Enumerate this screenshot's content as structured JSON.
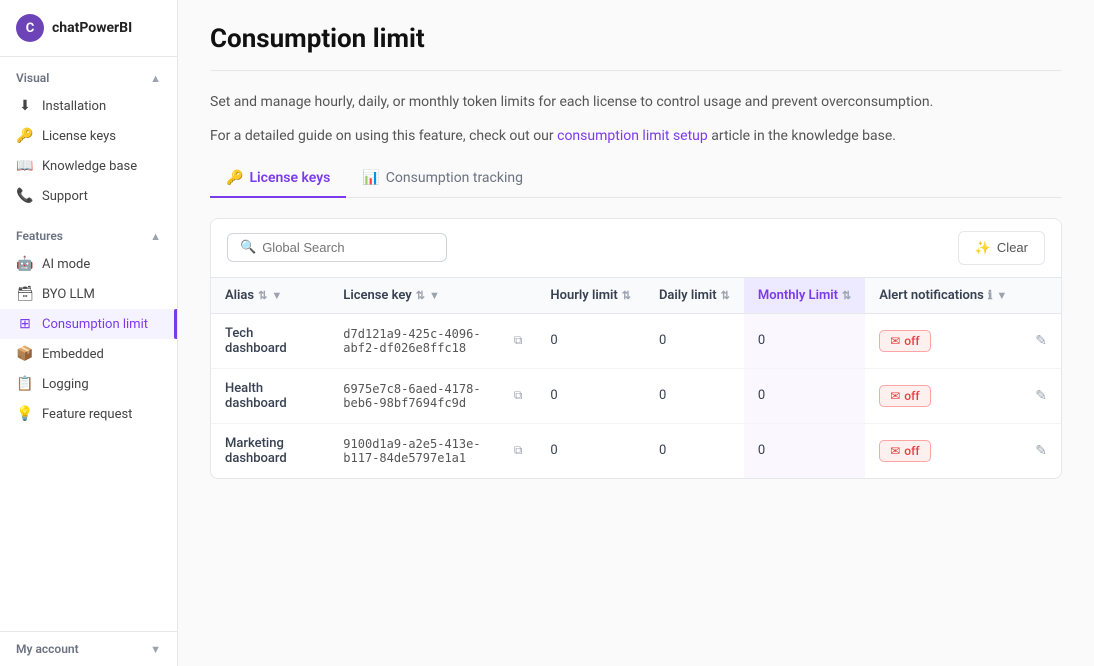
{
  "app": {
    "name": "chatPowerBI",
    "logo_initial": "C"
  },
  "sidebar": {
    "section_visual": "Visual",
    "section_features": "Features",
    "section_myaccount": "My account",
    "items_visual": [
      {
        "id": "installation",
        "label": "Installation",
        "icon": "⬇"
      },
      {
        "id": "license-keys",
        "label": "License keys",
        "icon": "🔑"
      },
      {
        "id": "knowledge-base",
        "label": "Knowledge base",
        "icon": "📖"
      },
      {
        "id": "support",
        "label": "Support",
        "icon": "📞"
      }
    ],
    "items_features": [
      {
        "id": "ai-mode",
        "label": "AI mode",
        "icon": "🤖"
      },
      {
        "id": "byo-llm",
        "label": "BYO LLM",
        "icon": "🗃"
      },
      {
        "id": "consumption-limit",
        "label": "Consumption limit",
        "icon": "⊞",
        "active": true
      },
      {
        "id": "embedded",
        "label": "Embedded",
        "icon": "📦"
      },
      {
        "id": "logging",
        "label": "Logging",
        "icon": "📋"
      },
      {
        "id": "feature-request",
        "label": "Feature request",
        "icon": "💡"
      }
    ],
    "items_myaccount": [
      {
        "id": "my-account",
        "label": "My account",
        "icon": "👤"
      }
    ]
  },
  "page": {
    "title": "Consumption limit",
    "description1": "Set and manage hourly, daily, or monthly token limits for each license to control usage and prevent overconsumption.",
    "description2_prefix": "For a detailed guide on using this feature, check out our ",
    "description2_link": "consumption limit setup",
    "description2_suffix": " article in the knowledge base.",
    "link_url": "#"
  },
  "tabs": [
    {
      "id": "license-keys",
      "label": "License keys",
      "icon": "🔑",
      "active": true
    },
    {
      "id": "consumption-tracking",
      "label": "Consumption tracking",
      "icon": "📊",
      "active": false
    }
  ],
  "toolbar": {
    "search_placeholder": "Global Search",
    "clear_label": "Clear"
  },
  "table": {
    "columns": [
      {
        "id": "alias",
        "label": "Alias",
        "sortable": true,
        "filterable": true
      },
      {
        "id": "license-key",
        "label": "License key",
        "sortable": true,
        "filterable": true
      },
      {
        "id": "hourly-limit",
        "label": "Hourly limit",
        "sortable": true,
        "filterable": false
      },
      {
        "id": "daily-limit",
        "label": "Daily limit",
        "sortable": true,
        "filterable": false
      },
      {
        "id": "monthly-limit",
        "label": "Monthly Limit",
        "sortable": true,
        "filterable": false,
        "sorted": true
      },
      {
        "id": "alert-notifications",
        "label": "Alert notifications",
        "sortable": false,
        "filterable": true,
        "info": true
      },
      {
        "id": "actions",
        "label": "",
        "sortable": false,
        "filterable": false
      }
    ],
    "rows": [
      {
        "alias": "Tech dashboard",
        "license_key": "d7d121a9-425c-4096-abf2-df026e8ffc18",
        "hourly_limit": "0",
        "daily_limit": "0",
        "monthly_limit": "0",
        "alert_status": "off"
      },
      {
        "alias": "Health dashboard",
        "license_key": "6975e7c8-6aed-4178-beb6-98bf7694fc9d",
        "hourly_limit": "0",
        "daily_limit": "0",
        "monthly_limit": "0",
        "alert_status": "off"
      },
      {
        "alias": "Marketing dashboard",
        "license_key": "9100d1a9-a2e5-413e-b117-84de5797e1a1",
        "hourly_limit": "0",
        "daily_limit": "0",
        "monthly_limit": "0",
        "alert_status": "off"
      }
    ]
  }
}
